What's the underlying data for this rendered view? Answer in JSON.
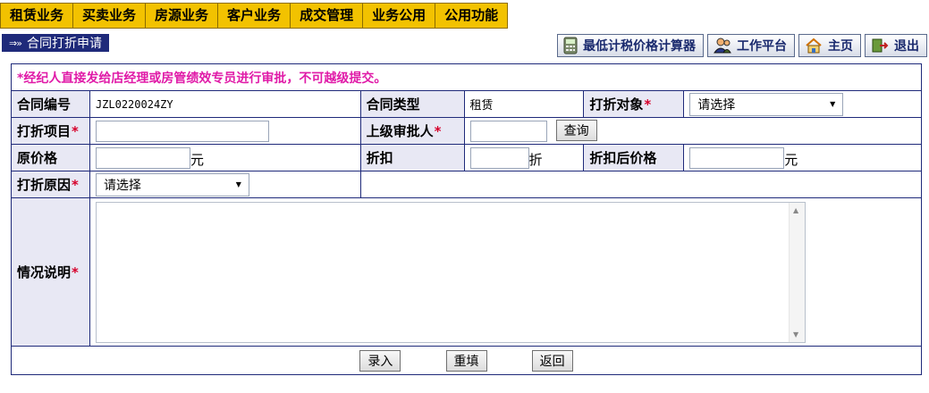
{
  "menu": {
    "items": [
      "租赁业务",
      "买卖业务",
      "房源业务",
      "客户业务",
      "成交管理",
      "业务公用",
      "公用功能"
    ]
  },
  "page": {
    "title": "合同打折申请",
    "title_arrow": "⇒»"
  },
  "toolbar": {
    "calculator": "最低计税价格计算器",
    "workspace": "工作平台",
    "home": "主页",
    "exit": "退出"
  },
  "form": {
    "notice": "*经纪人直接发给店经理或房管绩效专员进行审批，不可越级提交。",
    "required_mark": "*",
    "contract_no_label": "合同编号",
    "contract_no_value": "JZL0220024ZY",
    "contract_type_label": "合同类型",
    "contract_type_value": "租赁",
    "discount_target_label": "打折对象",
    "discount_target_value": "请选择",
    "discount_item_label": "打折项目",
    "discount_item_value": "",
    "approver_label": "上级审批人",
    "approver_value": "",
    "query_button": "查询",
    "original_price_label": "原价格",
    "original_price_value": "",
    "unit_yuan": "元",
    "discount_label": "折扣",
    "discount_value": "",
    "unit_zhe": "折",
    "after_price_label": "折扣后价格",
    "after_price_value": "",
    "reason_label": "打折原因",
    "reason_value": "请选择",
    "description_label": "情况说明",
    "description_value": ""
  },
  "actions": {
    "submit": "录入",
    "reset": "重填",
    "back": "返回"
  },
  "colors": {
    "menu_bg": "#f2c200",
    "title_bg": "#1f2a7a",
    "notice_text": "#e01ba8",
    "required": "#d6002a",
    "label_bg": "#e8e8f4"
  },
  "icons": [
    "calculator-icon",
    "user-icon",
    "home-icon",
    "exit-icon"
  ]
}
